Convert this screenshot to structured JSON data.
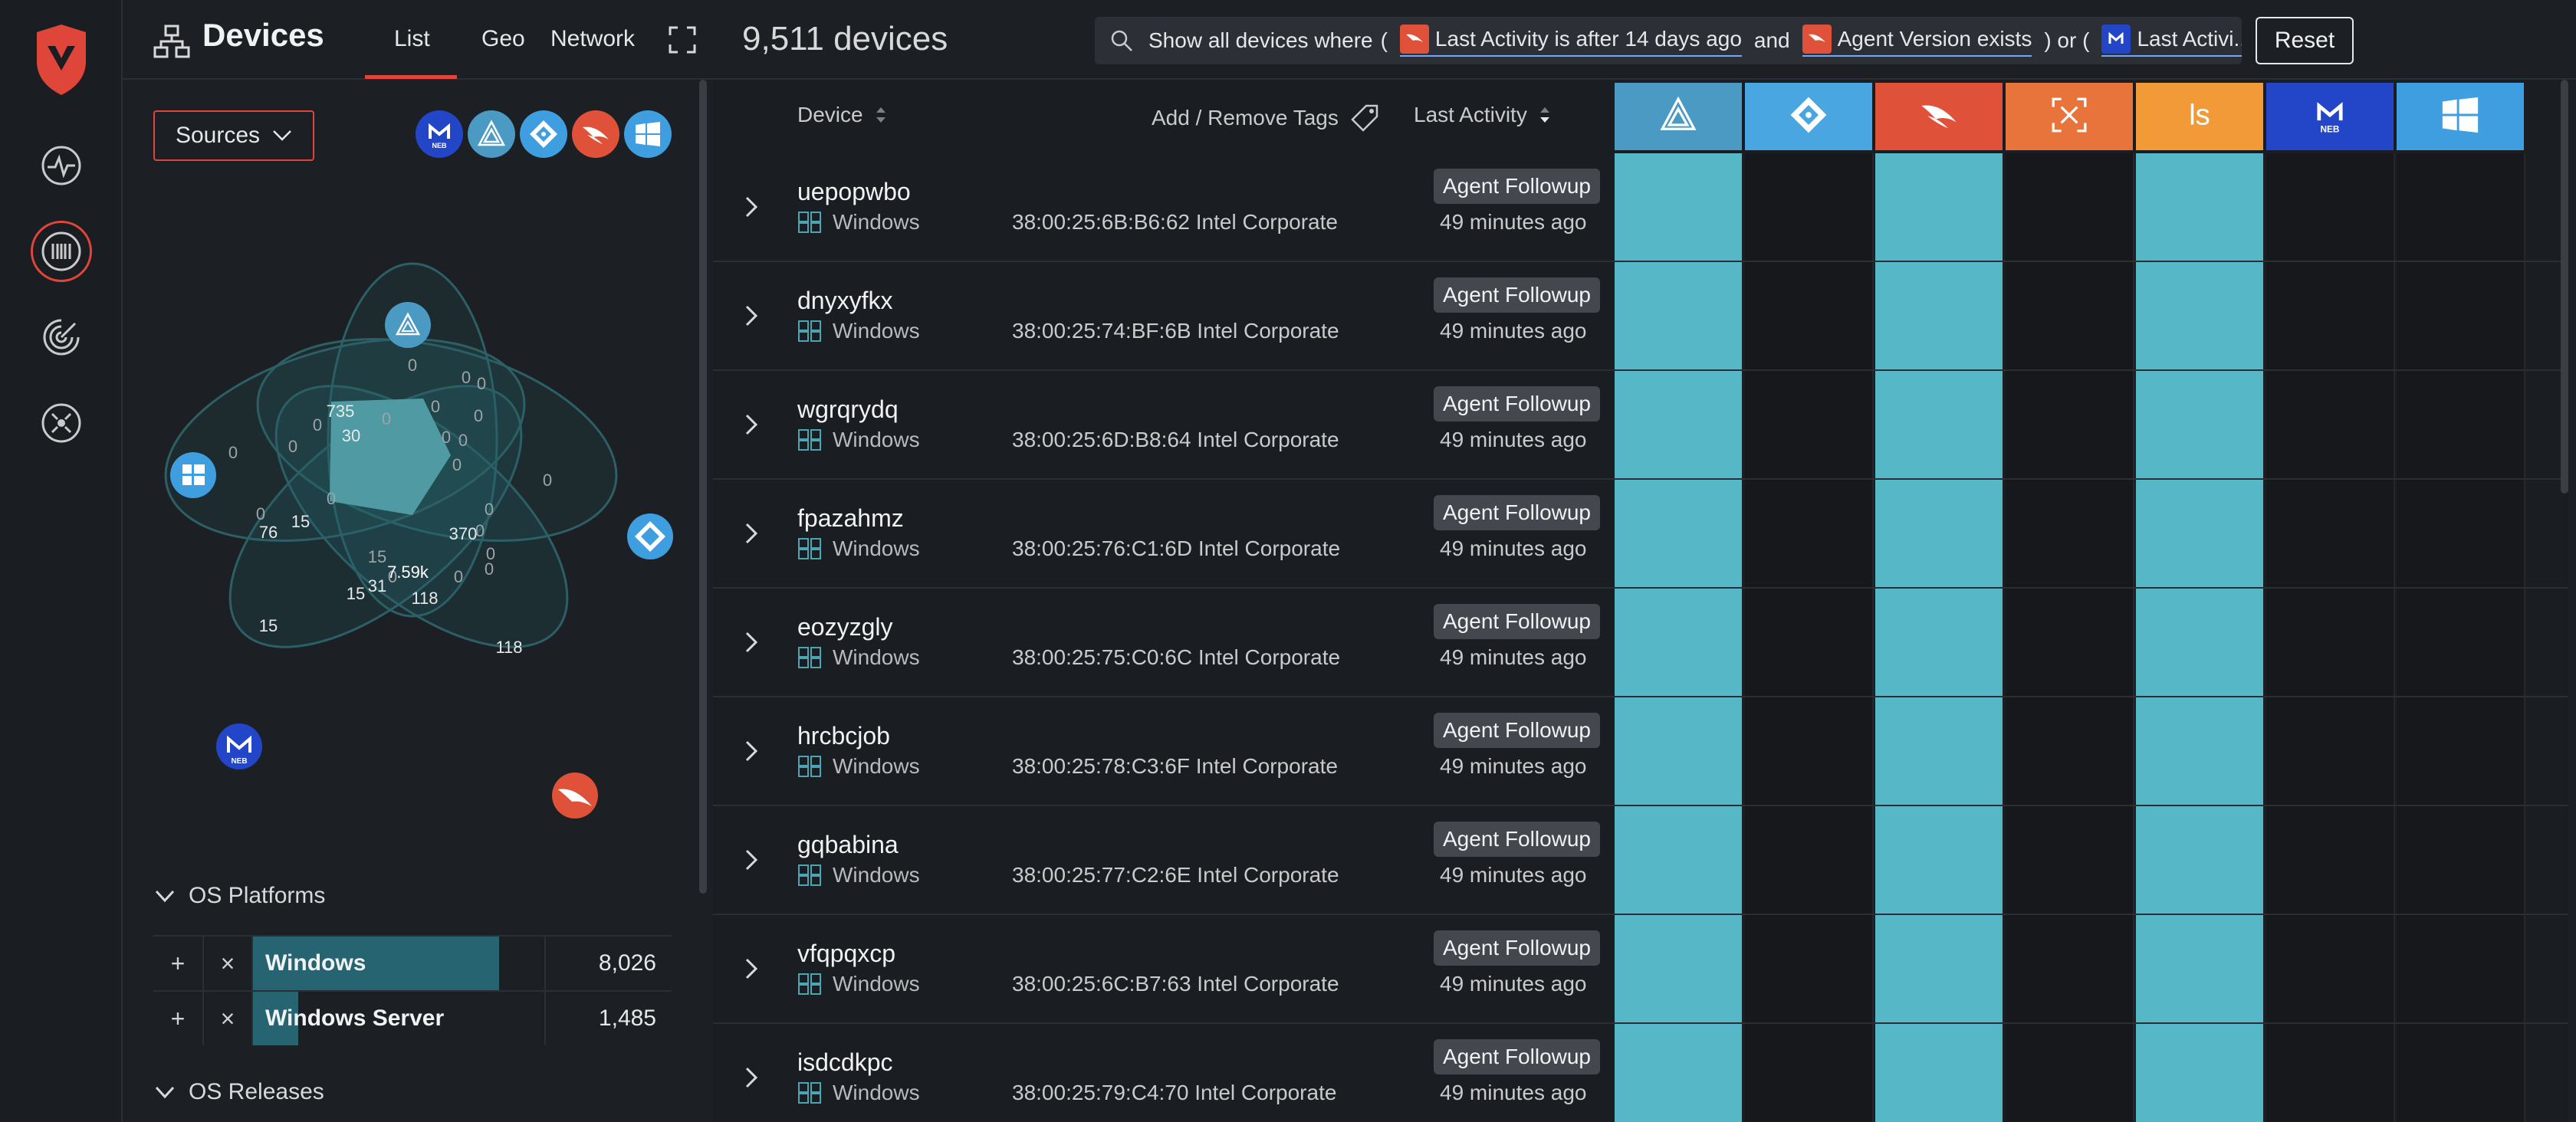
{
  "header": {
    "title": "Devices",
    "tabs": [
      {
        "label": "List",
        "active": true
      },
      {
        "label": "Geo",
        "active": false
      },
      {
        "label": "Network",
        "active": false
      }
    ],
    "device_count": "9,511 devices",
    "query": {
      "prefix": "Show all devices where",
      "open_paren_1": "(",
      "chip_1": "Last Activity is after 14 days ago",
      "and": "and",
      "chip_2": "Agent Version exists",
      "close_or": ") or (",
      "chip_3": "Last Activi..."
    },
    "reset_label": "Reset"
  },
  "panel": {
    "sources_label": "Sources",
    "source_icons": [
      "malwarebytes-icon",
      "aws-icon",
      "azure-icon",
      "crowdstrike-icon",
      "windows-icon"
    ],
    "venn": {
      "center": "7.59k",
      "labels": [
        "0",
        "735",
        "30",
        "0",
        "0",
        "0",
        "0",
        "0",
        "0",
        "0",
        "0",
        "0",
        "15",
        "76",
        "0",
        "370",
        "0",
        "0",
        "0",
        "0",
        "0",
        "15",
        "15",
        "31",
        "118",
        "0",
        "0",
        "0",
        "0",
        "0"
      ],
      "badge_labels": [
        "15",
        "118"
      ]
    },
    "os_platforms": {
      "title": "OS Platforms",
      "rows": [
        {
          "label": "Windows",
          "value": "8,026",
          "fraction": 0.844
        },
        {
          "label": "Windows Server",
          "value": "1,485",
          "fraction": 0.156
        }
      ]
    },
    "os_releases": {
      "title": "OS Releases"
    }
  },
  "table": {
    "columns": {
      "device": "Device",
      "tags": "Add / Remove Tags",
      "last_activity": "Last Activity"
    },
    "source_columns": [
      {
        "name": "aws-icon",
        "color": "#4a9ac4"
      },
      {
        "name": "azure-icon",
        "color": "#4aa6e0"
      },
      {
        "name": "crowdstrike-icon",
        "color": "#e0513a"
      },
      {
        "name": "forescout-icon",
        "color": "#e8743b"
      },
      {
        "name": "logstash-icon",
        "color": "#f19a37"
      },
      {
        "name": "malwarebytes-icon",
        "color": "#2346c9"
      },
      {
        "name": "windows-icon",
        "color": "#3e9ee0"
      }
    ],
    "rows": [
      {
        "name": "uepopwbo",
        "os": "Windows",
        "mac": "38:00:25:6B:B6:62",
        "vendor": "Intel Corporate",
        "tag": "Agent Followup",
        "time": "49 minutes ago",
        "sources": [
          1,
          0,
          1,
          0,
          1,
          0,
          0
        ]
      },
      {
        "name": "dnyxyfkx",
        "os": "Windows",
        "mac": "38:00:25:74:BF:6B",
        "vendor": "Intel Corporate",
        "tag": "Agent Followup",
        "time": "49 minutes ago",
        "sources": [
          1,
          0,
          1,
          0,
          1,
          0,
          0
        ]
      },
      {
        "name": "wgrqrydq",
        "os": "Windows",
        "mac": "38:00:25:6D:B8:64",
        "vendor": "Intel Corporate",
        "tag": "Agent Followup",
        "time": "49 minutes ago",
        "sources": [
          1,
          0,
          1,
          0,
          1,
          0,
          0
        ]
      },
      {
        "name": "fpazahmz",
        "os": "Windows",
        "mac": "38:00:25:76:C1:6D",
        "vendor": "Intel Corporate",
        "tag": "Agent Followup",
        "time": "49 minutes ago",
        "sources": [
          1,
          0,
          1,
          0,
          1,
          0,
          0
        ]
      },
      {
        "name": "eozyzgly",
        "os": "Windows",
        "mac": "38:00:25:75:C0:6C",
        "vendor": "Intel Corporate",
        "tag": "Agent Followup",
        "time": "49 minutes ago",
        "sources": [
          1,
          0,
          1,
          0,
          1,
          0,
          0
        ]
      },
      {
        "name": "hrcbcjob",
        "os": "Windows",
        "mac": "38:00:25:78:C3:6F",
        "vendor": "Intel Corporate",
        "tag": "Agent Followup",
        "time": "49 minutes ago",
        "sources": [
          1,
          0,
          1,
          0,
          1,
          0,
          0
        ]
      },
      {
        "name": "gqbabina",
        "os": "Windows",
        "mac": "38:00:25:77:C2:6E",
        "vendor": "Intel Corporate",
        "tag": "Agent Followup",
        "time": "49 minutes ago",
        "sources": [
          1,
          0,
          1,
          0,
          1,
          0,
          0
        ]
      },
      {
        "name": "vfqpqxcp",
        "os": "Windows",
        "mac": "38:00:25:6C:B7:63",
        "vendor": "Intel Corporate",
        "tag": "Agent Followup",
        "time": "49 minutes ago",
        "sources": [
          1,
          0,
          1,
          0,
          1,
          0,
          0
        ]
      },
      {
        "name": "isdcdkpc",
        "os": "Windows",
        "mac": "38:00:25:79:C4:70",
        "vendor": "Intel Corporate",
        "tag": "Agent Followup",
        "time": "49 minutes ago",
        "sources": [
          1,
          0,
          1,
          0,
          1,
          0,
          0
        ]
      }
    ]
  },
  "colors": {
    "accent": "#e0453a",
    "present": "#56b8c6",
    "bar": "#256470"
  }
}
